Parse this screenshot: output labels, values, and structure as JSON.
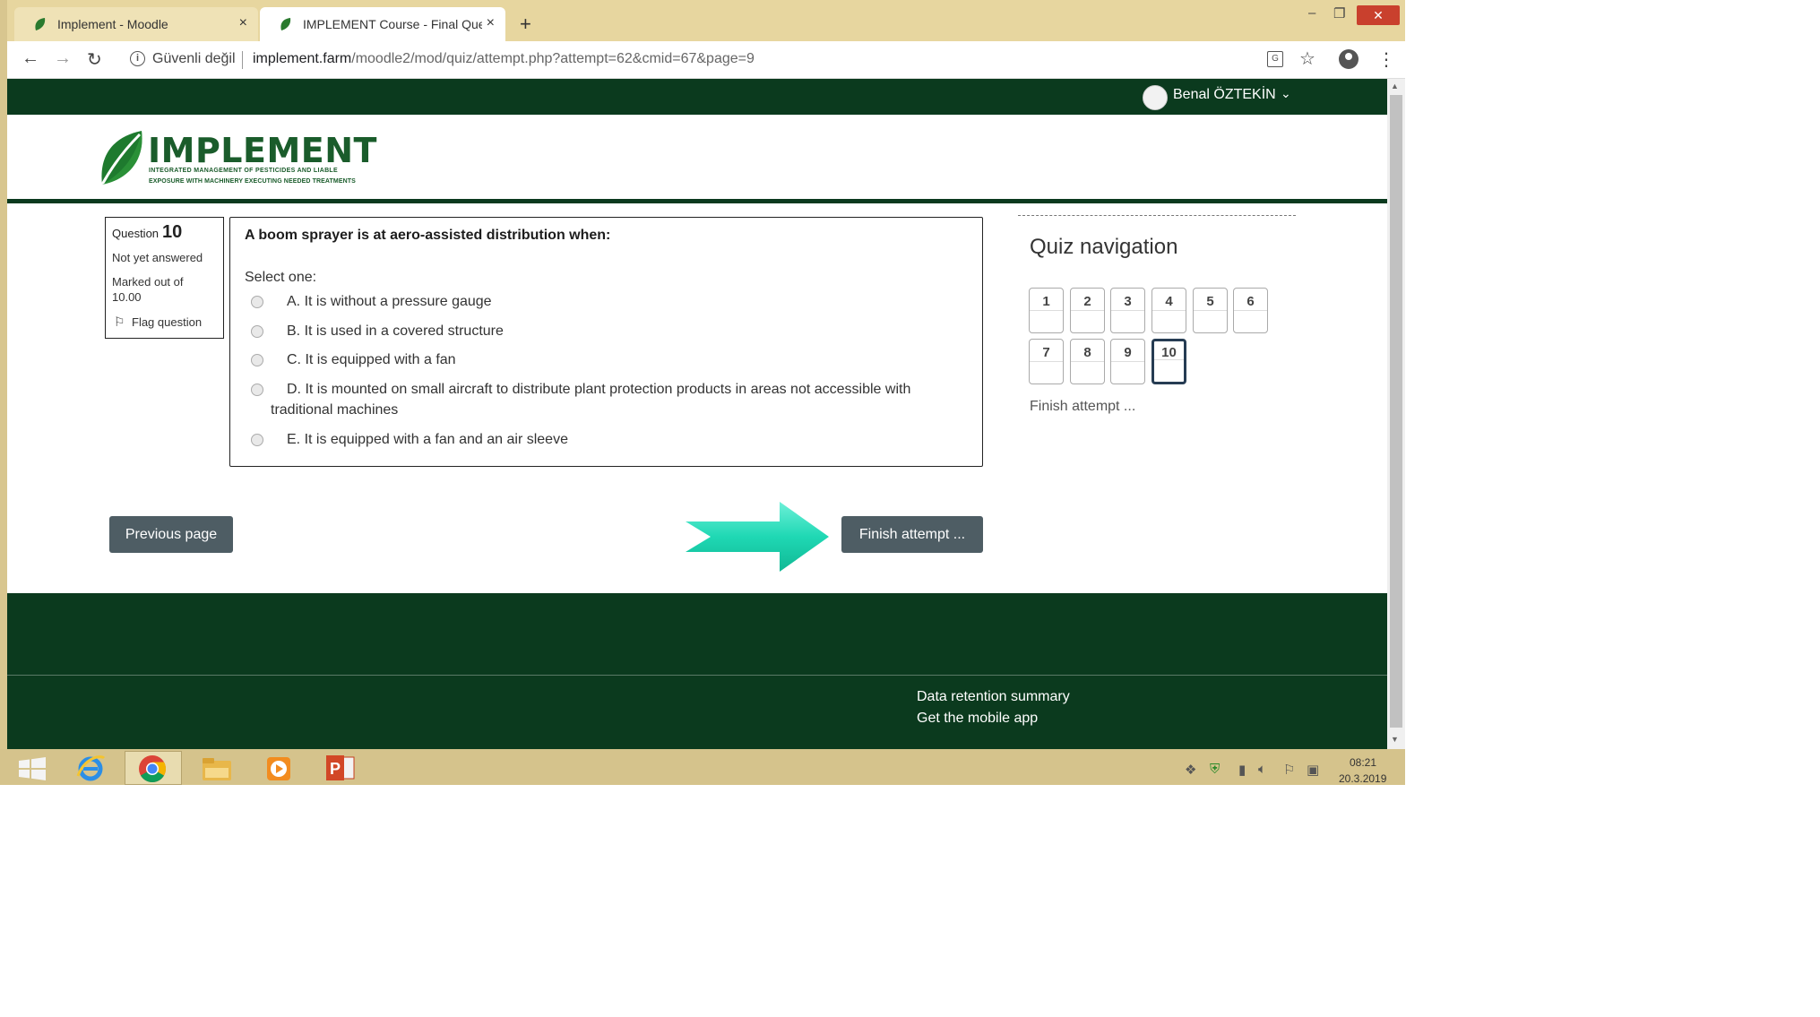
{
  "browser": {
    "tabs": [
      {
        "title": "Implement - Moodle",
        "close": "×"
      },
      {
        "title": "IMPLEMENT Course - Final Quest",
        "close": "×"
      }
    ],
    "new_tab": "+",
    "window_controls": {
      "minimize": "–",
      "maximize": "❐",
      "close": "✕"
    },
    "nav": {
      "back": "←",
      "forward": "→",
      "reload": "↻"
    },
    "security_label": "Güvenli değil",
    "url_host": "implement.farm",
    "url_path": "/moodle2/mod/quiz/attempt.php?attempt=62&cmid=67&page=9",
    "star": "☆",
    "menu": "⋮"
  },
  "user": {
    "name": "Benal ÖZTEKİN",
    "caret": "⌄"
  },
  "logo": {
    "title": "IMPLEMENT",
    "subtitle_line1": "INTEGRATED MANAGEMENT OF PESTICIDES AND LIABLE",
    "subtitle_line2": "EXPOSURE WITH MACHINERY EXECUTING NEEDED TREATMENTS"
  },
  "question": {
    "label": "Question",
    "number": "10",
    "state": "Not yet answered",
    "marked": "Marked out of 10.00",
    "flag": "Flag question",
    "text": "A boom sprayer is at aero-assisted distribution when:",
    "prompt": "Select one:",
    "options": [
      "A. It is without a pressure gauge",
      "B. It is used in a covered structure",
      "C. It is equipped with a fan",
      "D. It is mounted on small aircraft to distribute plant protection products in areas not accessible with traditional machines",
      "E. It is equipped with a fan and an air sleeve"
    ]
  },
  "buttons": {
    "previous": "Previous page",
    "finish": "Finish attempt ..."
  },
  "quiz_nav": {
    "title": "Quiz navigation",
    "items": [
      "1",
      "2",
      "3",
      "4",
      "5",
      "6",
      "7",
      "8",
      "9",
      "10"
    ],
    "current": "10",
    "finish_link": "Finish attempt ..."
  },
  "footer": {
    "data_retention": "Data retention summary",
    "mobile_app": "Get the mobile app"
  },
  "taskbar": {
    "time": "08:21",
    "date": "20.3.2019"
  },
  "colors": {
    "brand_dark": "#0b3a1e",
    "button": "#4e5d64",
    "arrow": "#1fd8b4",
    "logo_green": "#1a5c2b"
  }
}
